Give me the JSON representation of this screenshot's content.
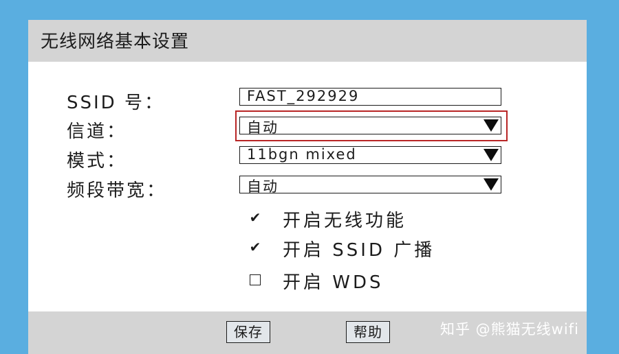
{
  "title": "无线网络基本设置",
  "fields": {
    "ssid": {
      "label": "SSID 号：",
      "value": "FAST_292929"
    },
    "channel": {
      "label": "信道：",
      "value": "自动"
    },
    "mode": {
      "label": "模式：",
      "value": "11bgn mixed"
    },
    "bandwidth": {
      "label": "频段带宽：",
      "value": "自动"
    }
  },
  "checkboxes": [
    {
      "label": "开启无线功能",
      "checked": true,
      "mark": "✔"
    },
    {
      "label": "开启 SSID 广播",
      "checked": true,
      "mark": "✔"
    },
    {
      "label": "开启 WDS",
      "checked": false,
      "mark": ""
    }
  ],
  "buttons": {
    "save": "保存",
    "help": "帮助"
  },
  "watermark": "知乎 @熊猫无线wifi",
  "colors": {
    "background": "#5aaee0",
    "bar": "#d4d4d4",
    "highlight": "#b82525"
  }
}
